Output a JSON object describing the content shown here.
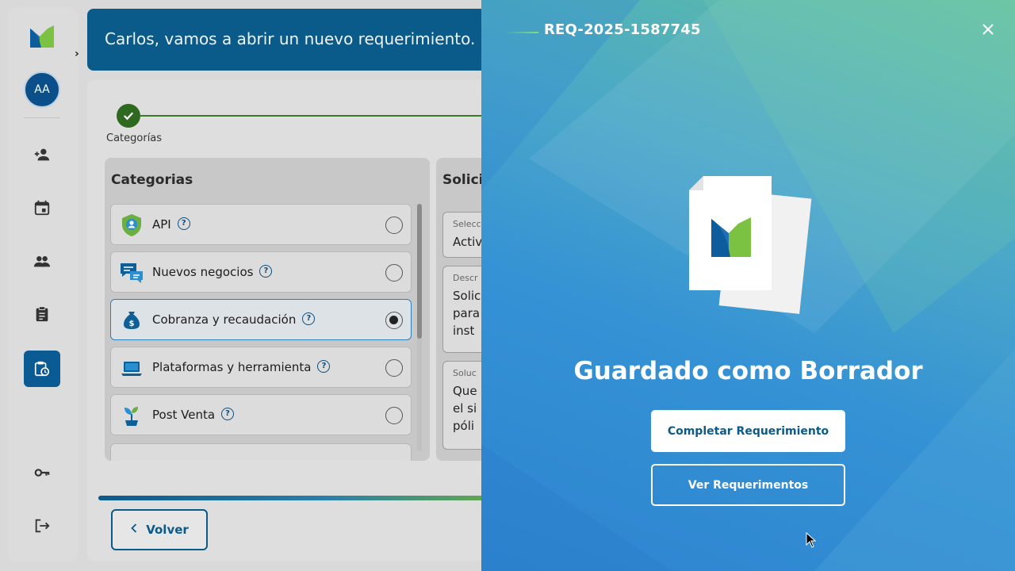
{
  "header": {
    "greeting": "Carlos, vamos a abrir un nuevo requerimiento."
  },
  "user": {
    "initials": "AA"
  },
  "sidebar": {
    "items": [
      {
        "icon": "add-person-icon"
      },
      {
        "icon": "calendar-icon"
      },
      {
        "icon": "group-icon"
      },
      {
        "icon": "clipboard-icon"
      },
      {
        "icon": "clipboard-clock-icon",
        "active": true
      },
      {
        "icon": "key-icon"
      },
      {
        "icon": "logout-icon"
      }
    ]
  },
  "stepper": {
    "steps": [
      {
        "label": "Categorías",
        "done": true
      }
    ]
  },
  "categories": {
    "title": "Categorias",
    "items": [
      {
        "label": "API",
        "icon": "shield-user-icon",
        "selected": false
      },
      {
        "label": "Nuevos negocios",
        "icon": "chat-bubbles-icon",
        "selected": false
      },
      {
        "label": "Cobranza y recaudación",
        "icon": "money-bag-icon",
        "selected": true
      },
      {
        "label": "Plataformas y herramienta",
        "icon": "laptop-icon",
        "selected": false
      },
      {
        "label": "Post Venta",
        "icon": "sprout-icon",
        "selected": false
      }
    ]
  },
  "solicitud": {
    "title": "Solicitud",
    "fields": [
      {
        "small": "Selecc",
        "lines": [
          "Activ"
        ]
      },
      {
        "small": "Descr",
        "lines": [
          "Solic",
          "para",
          "inst"
        ]
      },
      {
        "small": "Soluc",
        "lines": [
          "Que",
          "el si",
          "póli"
        ]
      }
    ]
  },
  "footer": {
    "back_label": "Volver"
  },
  "modal": {
    "req_id": "REQ-2025-1587745",
    "title": "Guardado como Borrador",
    "primary_label": "Completar Requerimiento",
    "secondary_label": "Ver Requerimentos"
  },
  "colors": {
    "brand_blue": "#0a5a8a",
    "brand_green": "#6cae3f",
    "modal_gradient_top": "#5fc0a0",
    "modal_gradient_bottom": "#2d84d0"
  }
}
